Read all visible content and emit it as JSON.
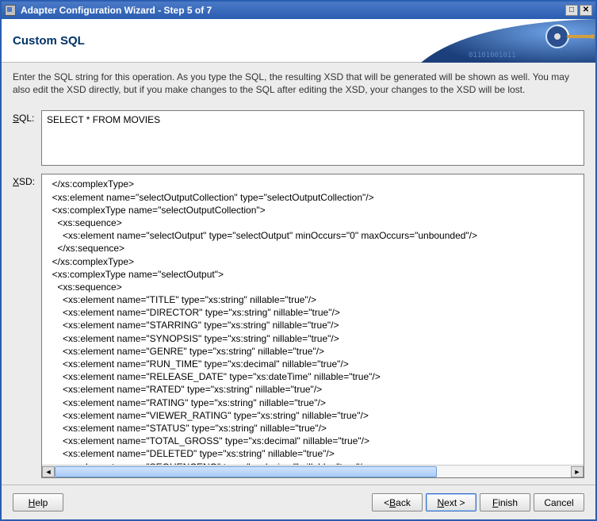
{
  "window": {
    "title": "Adapter Configuration Wizard - Step 5 of 7"
  },
  "banner": {
    "title": "Custom SQL"
  },
  "instructions": "Enter the SQL string for this operation.  As you type the SQL, the resulting XSD that will be generated will be shown as well.  You may also edit the XSD directly, but if you make changes to the SQL after editing the XSD, your changes to the XSD will be lost.",
  "labels": {
    "sql_prefix": "S",
    "sql_suffix": "QL:",
    "xsd_prefix": "X",
    "xsd_suffix": "SD:"
  },
  "sql": {
    "value": "SELECT * FROM MOVIES"
  },
  "xsd": {
    "text": "  </xs:complexType>\n  <xs:element name=\"selectOutputCollection\" type=\"selectOutputCollection\"/>\n  <xs:complexType name=\"selectOutputCollection\">\n    <xs:sequence>\n      <xs:element name=\"selectOutput\" type=\"selectOutput\" minOccurs=\"0\" maxOccurs=\"unbounded\"/>\n    </xs:sequence>\n  </xs:complexType>\n  <xs:complexType name=\"selectOutput\">\n    <xs:sequence>\n      <xs:element name=\"TITLE\" type=\"xs:string\" nillable=\"true\"/>\n      <xs:element name=\"DIRECTOR\" type=\"xs:string\" nillable=\"true\"/>\n      <xs:element name=\"STARRING\" type=\"xs:string\" nillable=\"true\"/>\n      <xs:element name=\"SYNOPSIS\" type=\"xs:string\" nillable=\"true\"/>\n      <xs:element name=\"GENRE\" type=\"xs:string\" nillable=\"true\"/>\n      <xs:element name=\"RUN_TIME\" type=\"xs:decimal\" nillable=\"true\"/>\n      <xs:element name=\"RELEASE_DATE\" type=\"xs:dateTime\" nillable=\"true\"/>\n      <xs:element name=\"RATED\" type=\"xs:string\" nillable=\"true\"/>\n      <xs:element name=\"RATING\" type=\"xs:string\" nillable=\"true\"/>\n      <xs:element name=\"VIEWER_RATING\" type=\"xs:string\" nillable=\"true\"/>\n      <xs:element name=\"STATUS\" type=\"xs:string\" nillable=\"true\"/>\n      <xs:element name=\"TOTAL_GROSS\" type=\"xs:decimal\" nillable=\"true\"/>\n      <xs:element name=\"DELETED\" type=\"xs:string\" nillable=\"true\"/>\n      <xs:element name=\"SEQUENCENO\" type=\"xs:decimal\" nillable=\"true\"/>\n      <xs:element name=\"LAST_UPDATED\" type=\"xs:dateTime\" nillable=\"true\"/>"
  },
  "buttons": {
    "help": "elp",
    "help_prefix": "H",
    "back": "ack",
    "back_prefix": "< B",
    "next": "ext >",
    "next_prefix": "N",
    "finish": "inish",
    "finish_prefix": "F",
    "cancel": "Cancel"
  }
}
